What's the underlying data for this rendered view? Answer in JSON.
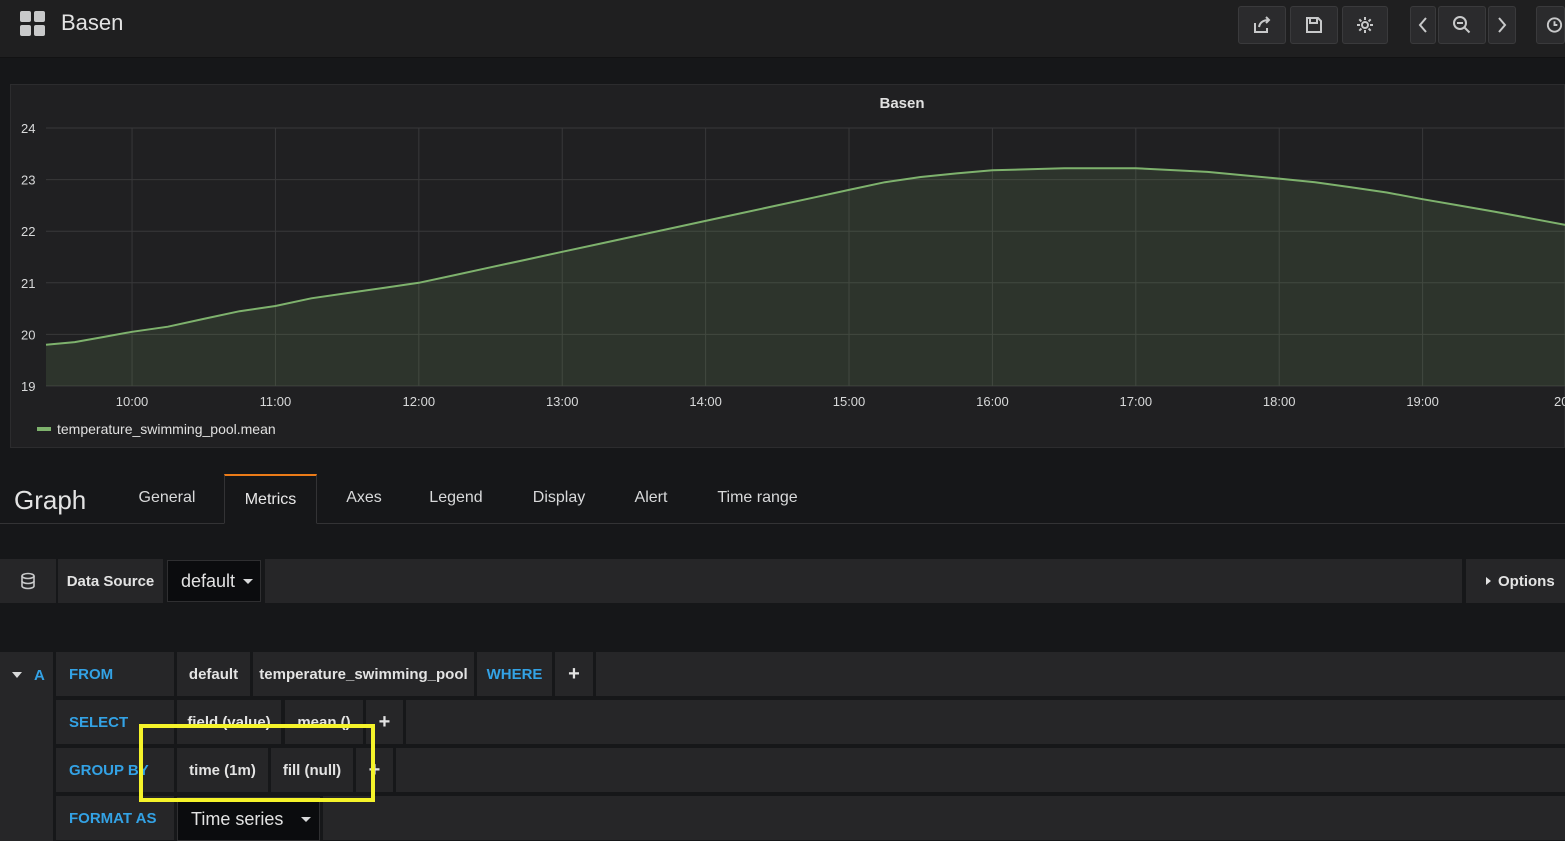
{
  "topbar": {
    "title": "Basen",
    "buttons": [
      "share-icon",
      "save-icon",
      "gear-icon",
      "chevron-left-icon",
      "zoom-out-icon",
      "chevron-right-icon",
      "clock-icon"
    ]
  },
  "panel": {
    "title": "Basen",
    "legend": "temperature_swimming_pool.mean"
  },
  "chart_data": {
    "type": "line",
    "title": "Basen",
    "x_ticks": [
      "10:00",
      "11:00",
      "12:00",
      "13:00",
      "14:00",
      "15:00",
      "16:00",
      "17:00",
      "18:00",
      "19:00",
      "20"
    ],
    "y_ticks": [
      19,
      20,
      21,
      22,
      23,
      24
    ],
    "ylim": [
      19,
      24
    ],
    "xlim_hours": [
      9.4,
      20.0
    ],
    "grid": true,
    "legend_placement": "bottom-left",
    "series": [
      {
        "name": "temperature_swimming_pool.mean",
        "color": "#7eb26d",
        "x": [
          9.4,
          9.6,
          9.8,
          10.0,
          10.25,
          10.5,
          10.75,
          11.0,
          11.25,
          11.5,
          11.75,
          12.0,
          12.25,
          12.5,
          12.75,
          13.0,
          13.25,
          13.5,
          13.75,
          14.0,
          14.25,
          14.5,
          14.75,
          15.0,
          15.25,
          15.5,
          15.75,
          16.0,
          16.5,
          17.0,
          17.5,
          18.0,
          18.25,
          18.5,
          18.75,
          19.0,
          19.25,
          19.5,
          19.75,
          20.0
        ],
        "y": [
          19.8,
          19.85,
          19.95,
          20.05,
          20.15,
          20.3,
          20.45,
          20.55,
          20.7,
          20.8,
          20.9,
          21.0,
          21.15,
          21.3,
          21.45,
          21.6,
          21.75,
          21.9,
          22.05,
          22.2,
          22.35,
          22.5,
          22.65,
          22.8,
          22.95,
          23.05,
          23.12,
          23.18,
          23.22,
          23.22,
          23.15,
          23.02,
          22.95,
          22.85,
          22.75,
          22.62,
          22.5,
          22.38,
          22.25,
          22.12
        ]
      }
    ]
  },
  "editor": {
    "title": "Graph",
    "tabs": [
      "General",
      "Metrics",
      "Axes",
      "Legend",
      "Display",
      "Alert",
      "Time range"
    ],
    "active_tab": "Metrics"
  },
  "datasource": {
    "label": "Data Source",
    "value": "default",
    "options_label": "Options"
  },
  "query": {
    "ref": "A",
    "from_label": "FROM",
    "from_db": "default",
    "from_measurement": "temperature_swimming_pool",
    "where_label": "WHERE",
    "select_label": "SELECT",
    "select_field": "field (value)",
    "select_func": "mean ()",
    "group_label": "GROUP BY",
    "group_time": "time (1m)",
    "group_fill": "fill (null)",
    "format_label": "FORMAT AS",
    "format_value": "Time series"
  }
}
